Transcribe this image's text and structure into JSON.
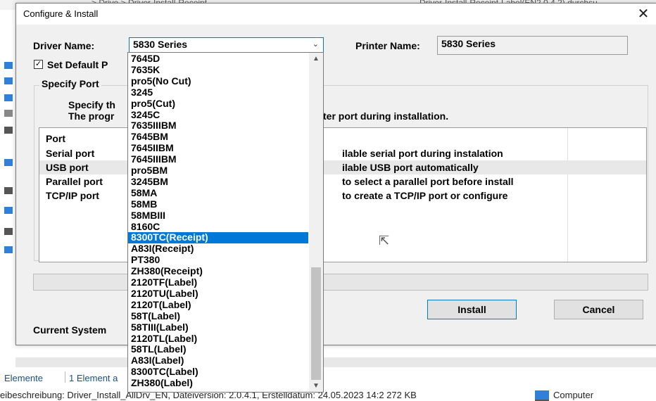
{
  "explorer": {
    "breadcrumb": "> Drive  >  Driver-Install-Receipt",
    "search_hint": "Driver-Install-Receipt-Label(EN2.0.4.2) durchsu",
    "status_count": "Elemente",
    "status_selected": "1 Element a",
    "details": "eibeschreibung: Driver_Install_AllDrv_EN, Dateiversion: 2.0.4.1, Erstelldatum: 24.05.2023 14:2  272 KB",
    "computer_label": "Computer"
  },
  "dialog": {
    "title": "Configure & Install",
    "close_glyph": "✕",
    "driver_name_label": "Driver Name:",
    "driver_name_value": "5830 Series",
    "printer_name_label": "Printer Name:",
    "printer_name_value": "5830 Series",
    "set_default_label": "Set Default P",
    "specify_port_title": "Specify Port",
    "specify_line1": "Specify th",
    "specify_line2": "The progr",
    "specify_line2_tail": "ter port during installation.",
    "port_header": "Port",
    "ports": [
      {
        "name": "Serial port",
        "desc": "ilable serial port during instalation"
      },
      {
        "name": "USB port",
        "desc": "ilable USB port automatically"
      },
      {
        "name": "Parallel port",
        "desc": "to select a parallel port before install"
      },
      {
        "name": "TCP/IP port",
        "desc": "to create a TCP/IP port or configure"
      }
    ],
    "current_system_label": "Current System",
    "install_label": "Install",
    "cancel_label": "Cancel"
  },
  "dropdown": {
    "selected_index": 16,
    "items": [
      "7645D",
      "7635K",
      "pro5(No Cut)",
      "3245",
      "pro5(Cut)",
      "3245C",
      "7635IIIBM",
      "7645BM",
      "7645IIBM",
      "7645IIIBM",
      "pro5BM",
      "3245BM",
      "58MA",
      "58MB",
      "58MBIII",
      "8160C",
      "8300TC(Receipt)",
      "A83I(Receipt)",
      "PT380",
      "ZH380(Receipt)",
      "2120TF(Label)",
      "2120TU(Label)",
      "2120T(Label)",
      "58T(Label)",
      "58TIII(Label)",
      "2120TL(Label)",
      "58TL(Label)",
      "A83I(Label)",
      "8300TC(Label)",
      "ZH380(Label)"
    ]
  },
  "colors": {
    "selection": "#0078d7",
    "dialog_bg": "#f0f0f0"
  }
}
